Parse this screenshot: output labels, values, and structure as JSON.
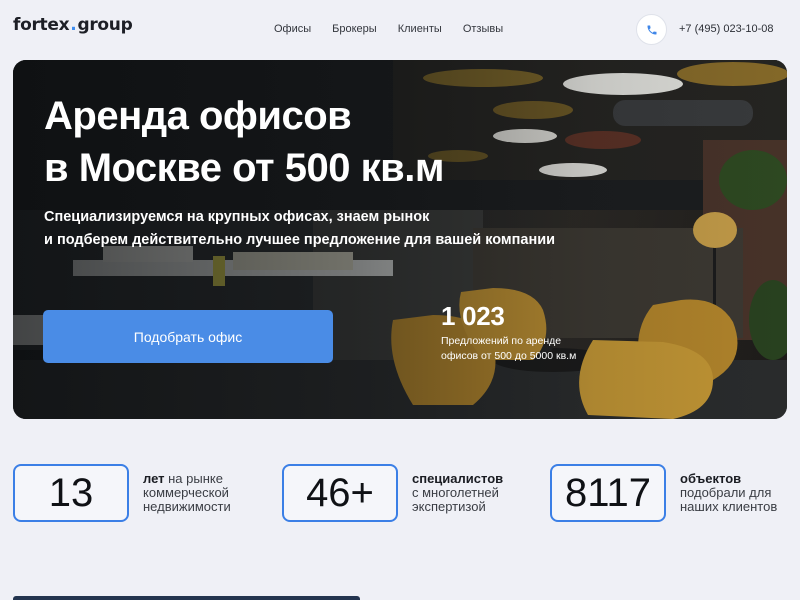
{
  "header": {
    "logo_part1": "fortex",
    "logo_dot": ".",
    "logo_part2": "group",
    "nav": [
      "Офисы",
      "Брокеры",
      "Клиенты",
      "Отзывы"
    ],
    "phone_icon": "phone-icon",
    "phone": "+7 (495) 023-10-08"
  },
  "hero": {
    "title_line1": "Аренда офисов",
    "title_line2": "в Москве от 500 кв.м",
    "subtitle_line1": "Специализируемся на крупных офисах, знаем рынок",
    "subtitle_line2": "и подберем действительно лучшее предложение для вашей компании",
    "cta_label": "Подобрать офис",
    "stat_value": "1 023",
    "stat_desc_line1": "Предложений по аренде",
    "stat_desc_line2": "офисов от 500 до 5000 кв.м"
  },
  "stats": [
    {
      "value": "13",
      "lead": "лет",
      "rest_inline": " на рынке",
      "line2": "коммерческой",
      "line3": "недвижимости"
    },
    {
      "value": "46+",
      "lead": "специалистов",
      "rest_inline": "",
      "line2": "с многолетней",
      "line3": "экспертизой"
    },
    {
      "value": "8117",
      "lead": "объектов",
      "rest_inline": "",
      "line2": "подобрали для",
      "line3": "наших клиентов"
    }
  ],
  "colors": {
    "accent": "#4a8ce6",
    "stat_border": "#3b7fe6",
    "logo_dot": "#3d8df0",
    "page_bg": "#eff0f6"
  }
}
